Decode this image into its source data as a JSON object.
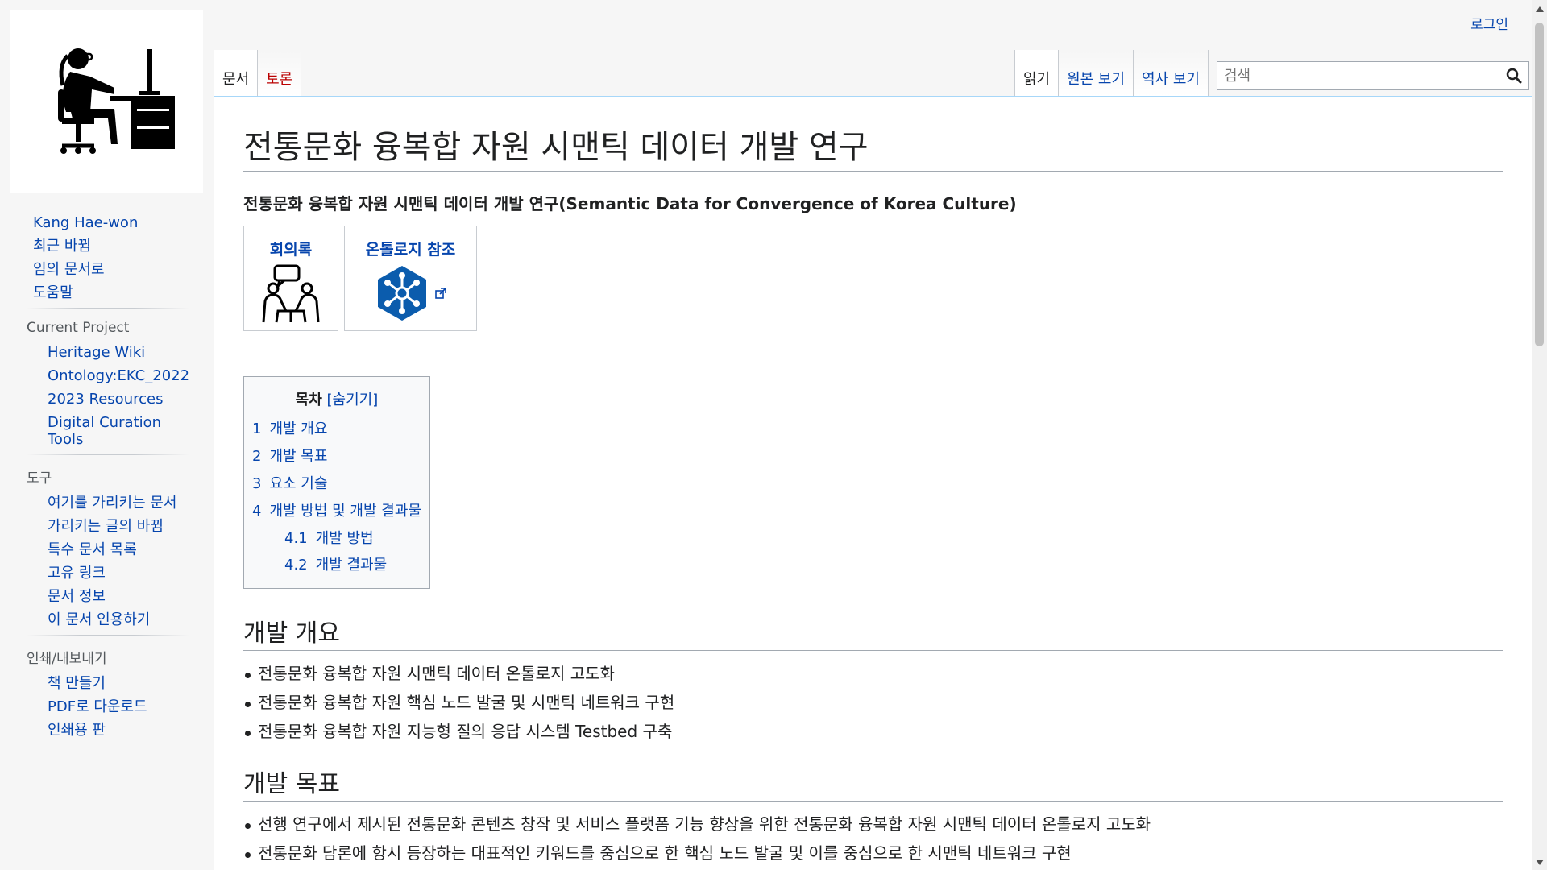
{
  "personal": {
    "login": "로그인"
  },
  "tabs": {
    "left": [
      {
        "label": "문서",
        "selected": true
      },
      {
        "label": "토론",
        "new": true
      }
    ],
    "right": [
      {
        "label": "읽기",
        "selected": true
      },
      {
        "label": "원본 보기"
      },
      {
        "label": "역사 보기"
      }
    ]
  },
  "search": {
    "placeholder": "검색"
  },
  "sidebar": {
    "nav": [
      "Kang Hae-won",
      "최근 바뀜",
      "임의 문서로",
      "도움말"
    ],
    "current_project": {
      "heading": "Current Project",
      "items": [
        "Heritage Wiki",
        "Ontology:EKC_2022",
        "2023 Resources",
        "Digital Curation Tools"
      ]
    },
    "tools": {
      "heading": "도구",
      "items": [
        "여기를 가리키는 문서",
        "가리키는 글의 바뀜",
        "특수 문서 목록",
        "고유 링크",
        "문서 정보",
        "이 문서 인용하기"
      ]
    },
    "print": {
      "heading": "인쇄/내보내기",
      "items": [
        "책 만들기",
        "PDF로 다운로드",
        "인쇄용 판"
      ]
    }
  },
  "page": {
    "title": "전통문화 융복합 자원 시맨틱 데이터 개발 연구",
    "subtitle": "전통문화 융복합 자원 시맨틱 데이터 개발 연구(Semantic Data for Convergence of Korea Culture)",
    "cards": [
      {
        "title": "회의록",
        "icon": "meeting-icon"
      },
      {
        "title": "온톨로지 참조",
        "icon": "ontology-network-icon",
        "external": true
      }
    ],
    "toc": {
      "title": "목차",
      "toggle": "[숨기기]",
      "items": [
        {
          "num": "1",
          "label": "개발 개요"
        },
        {
          "num": "2",
          "label": "개발 목표"
        },
        {
          "num": "3",
          "label": "요소 기술"
        },
        {
          "num": "4",
          "label": "개발 방법 및 개발 결과물"
        },
        {
          "num": "4.1",
          "label": "개발 방법"
        },
        {
          "num": "4.2",
          "label": "개발 결과물"
        }
      ]
    },
    "sections": [
      {
        "heading": "개발 개요",
        "bullets": [
          "전통문화 융복합 자원 시맨틱 데이터 온톨로지 고도화",
          "전통문화 융복합 자원 핵심 노드 발굴 및 시맨틱 네트워크 구현",
          "전통문화 융복합 자원 지능형 질의 응답 시스템 Testbed 구축"
        ]
      },
      {
        "heading": "개발 목표",
        "bullets": [
          "선행 연구에서 제시된 전통문화 콘텐츠 창작 및 서비스 플랫폼 기능 향상을 위한 전통문화 융복합 자원 시맨틱 데이터 온톨로지 고도화",
          "전통문화 담론에 항시 등장하는 대표적인 키워드를 중심으로 한 핵심 노드 발굴 및 이를 중심으로 한 시맨틱 네트워크 구현"
        ]
      }
    ]
  }
}
